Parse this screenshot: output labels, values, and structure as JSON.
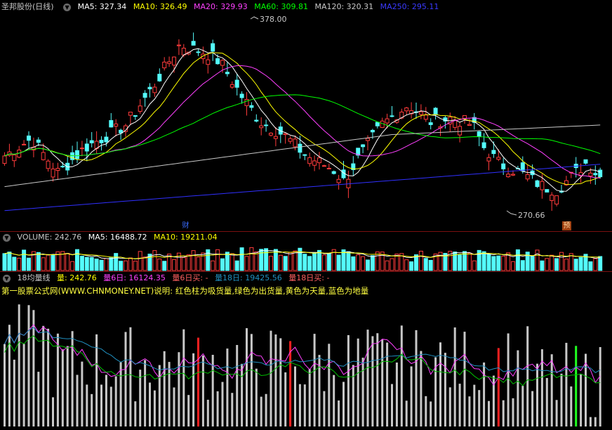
{
  "main": {
    "stock_title": "圣邦股份(日线)",
    "ma5": "MA5: 327.34",
    "ma10": "MA10: 326.49",
    "ma20": "MA20: 329.93",
    "ma60": "MA60: 309.81",
    "ma120": "MA120: 320.31",
    "ma250": "MA250: 295.11",
    "high_label": "378.00",
    "low_label": "270.66",
    "marker_cai": "财",
    "marker_yu": "预"
  },
  "volume": {
    "label": "VOLUME: 242.76",
    "ma5": "MA5: 16488.72",
    "ma10": "MA10: 19211.04"
  },
  "indicator": {
    "name": "18均量线",
    "liang": "量: 242.76",
    "liang6": "量6日: 16124.35",
    "liang6buy": "量6日买: -",
    "liang18": "量18日: 19425.56",
    "liang18buy": "量18日买: -",
    "note": "第一股票公式网(WWW.CHNMONEY.NET)说明: 红色柱为吸货量,绿色为出货量,黄色为天量,蓝色为地量"
  },
  "colors": {
    "up": "#ff3b3b",
    "down": "#54fcfc",
    "ma5": "#ffffff",
    "ma10": "#ffff00",
    "ma20": "#ff40ff",
    "ma60": "#00ff00",
    "ma120": "#c8c8c8",
    "ma250": "#3030ff",
    "grid": "#7a1010"
  }
}
